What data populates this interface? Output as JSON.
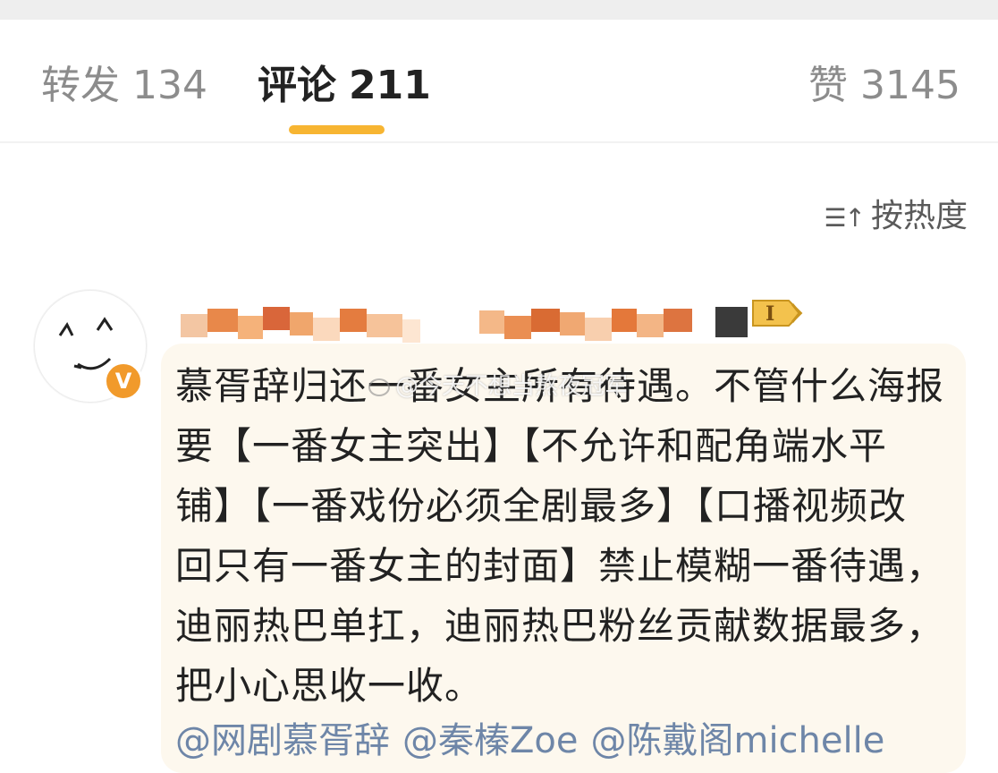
{
  "tabs": {
    "repost": {
      "label": "转发",
      "count": "134"
    },
    "comment": {
      "label": "评论",
      "count": "211"
    },
    "like": {
      "label": "赞",
      "count": "3145"
    }
  },
  "sort": {
    "icon": "sort-icon",
    "label": "按热度"
  },
  "comment": {
    "avatar_icon": "smiley-face-avatar",
    "verified_icon": "verified-v-icon",
    "verified_letter": "V",
    "level_badge_icon": "level-badge-icon",
    "username_blurred": true,
    "text": "慕胥辞归还一番女主所有待遇。不管什么海报要【一番女主突出】【不允许和配角端水平铺】【一番戏份必须全剧最多】【口播视频改回只有一番女主的封面】禁止模糊一番待遇，迪丽热巴单扛，迪丽热巴粉丝贡献数据最多，把小心思收一收。",
    "mentions": [
      "@网剧慕胥辞",
      "@秦榛Zoe",
      "@陈戴阁michelle"
    ]
  },
  "watermark": "@今天不想当熬夜冠军",
  "colors": {
    "tab_indicator": "#f7b532",
    "mention": "#6e86a8",
    "bubble": "#fdf8ee",
    "verified": "#f19a2b"
  }
}
